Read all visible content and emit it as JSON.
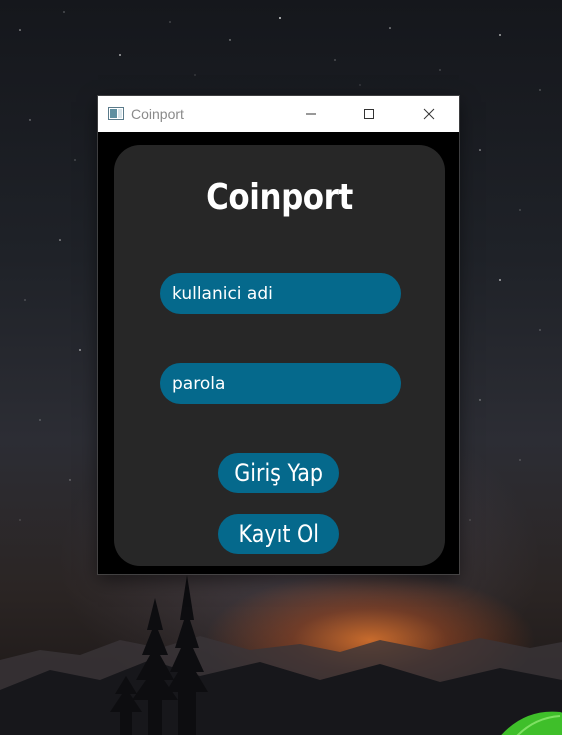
{
  "window": {
    "title": "Coinport",
    "controls": [
      "minimize",
      "maximize",
      "close"
    ]
  },
  "app": {
    "heading": "Coinport",
    "username_placeholder": "kullanici adi",
    "username_value": "",
    "password_placeholder": "parola",
    "password_value": "",
    "login_label": "Giriş Yap",
    "register_label": "Kayıt Ol"
  },
  "colors": {
    "card_background": "#272727",
    "accent": "#05698c",
    "window_background": "#000000",
    "text": "#ffffff"
  },
  "icons": {
    "app_icon": "window-app-icon",
    "minimize": "minimize-icon",
    "maximize": "maximize-icon",
    "close": "close-icon"
  }
}
